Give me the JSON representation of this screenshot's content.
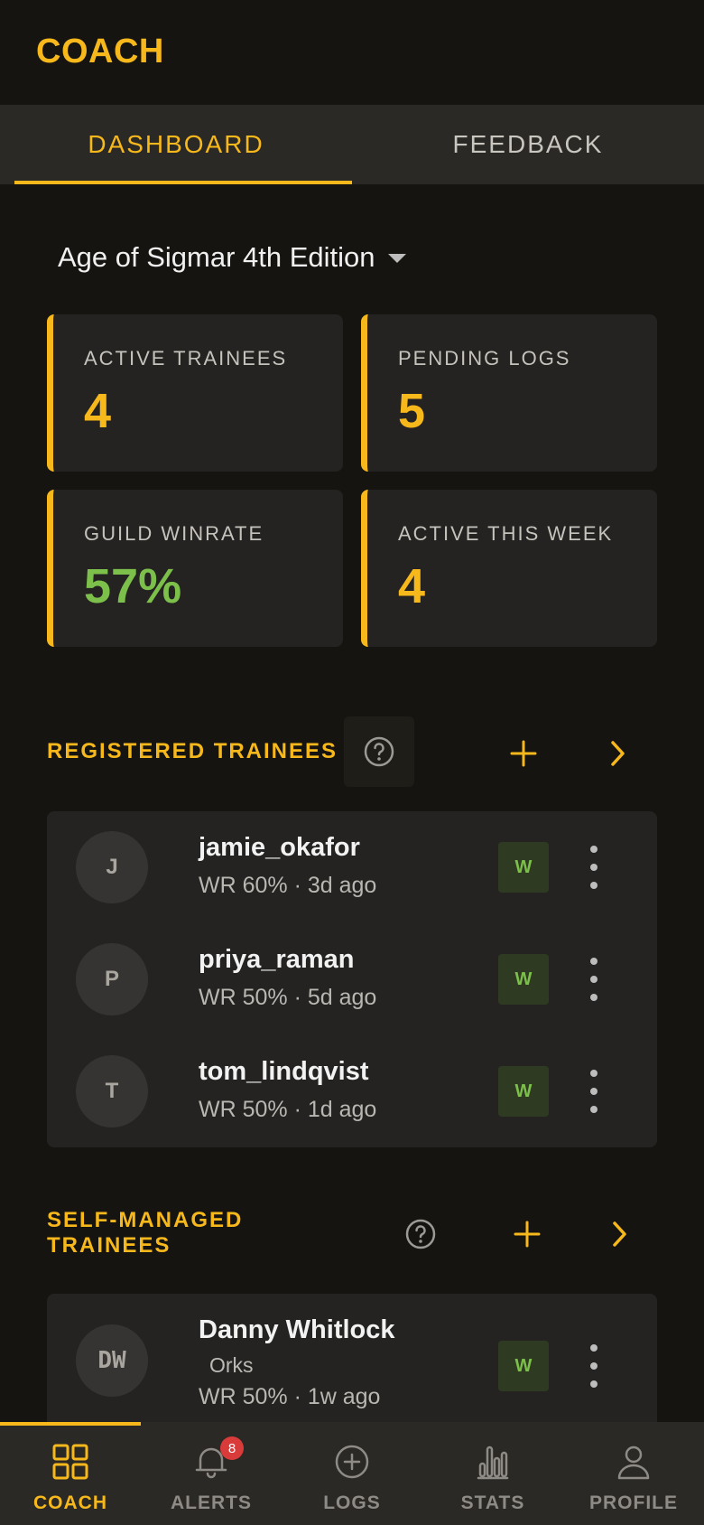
{
  "header": {
    "title": "COACH"
  },
  "tabs": [
    {
      "label": "DASHBOARD",
      "active": true
    },
    {
      "label": "FEEDBACK",
      "active": false
    }
  ],
  "game_select": {
    "value": "Age of Sigmar 4th Edition"
  },
  "stats": [
    {
      "label": "ACTIVE TRAINEES",
      "value": "4"
    },
    {
      "label": "PENDING LOGS",
      "value": "5"
    },
    {
      "label": "GUILD WINRATE",
      "value": "57%"
    },
    {
      "label": "ACTIVE THIS WEEK",
      "value": "4"
    }
  ],
  "registered": {
    "title": "REGISTERED TRAINEES",
    "items": [
      {
        "initial": "J",
        "name": "jamie_okafor",
        "meta": "WR 60% · 3d ago",
        "badge": "W"
      },
      {
        "initial": "P",
        "name": "priya_raman",
        "meta": "WR 50% · 5d ago",
        "badge": "W"
      },
      {
        "initial": "T",
        "name": "tom_lindqvist",
        "meta": "WR 50% · 1d ago",
        "badge": "W"
      }
    ]
  },
  "self_managed": {
    "title_line1": "SELF-MANAGED",
    "title_line2": "TRAINEES",
    "items": [
      {
        "initial": "DW",
        "name": "Danny Whitlock",
        "sub": "Orks",
        "meta": "WR 50% · 1w ago",
        "badge": "W"
      }
    ]
  },
  "nav": [
    {
      "label": "COACH",
      "icon": "grid-icon",
      "active": true
    },
    {
      "label": "ALERTS",
      "icon": "bell-icon",
      "badge": "8"
    },
    {
      "label": "LOGS",
      "icon": "plus-circle-icon"
    },
    {
      "label": "STATS",
      "icon": "bar-chart-icon"
    },
    {
      "label": "PROFILE",
      "icon": "user-icon"
    }
  ],
  "colors": {
    "accent": "#f7b81c",
    "success": "#7cc04b",
    "background": "#151410",
    "surface": "#242321"
  }
}
